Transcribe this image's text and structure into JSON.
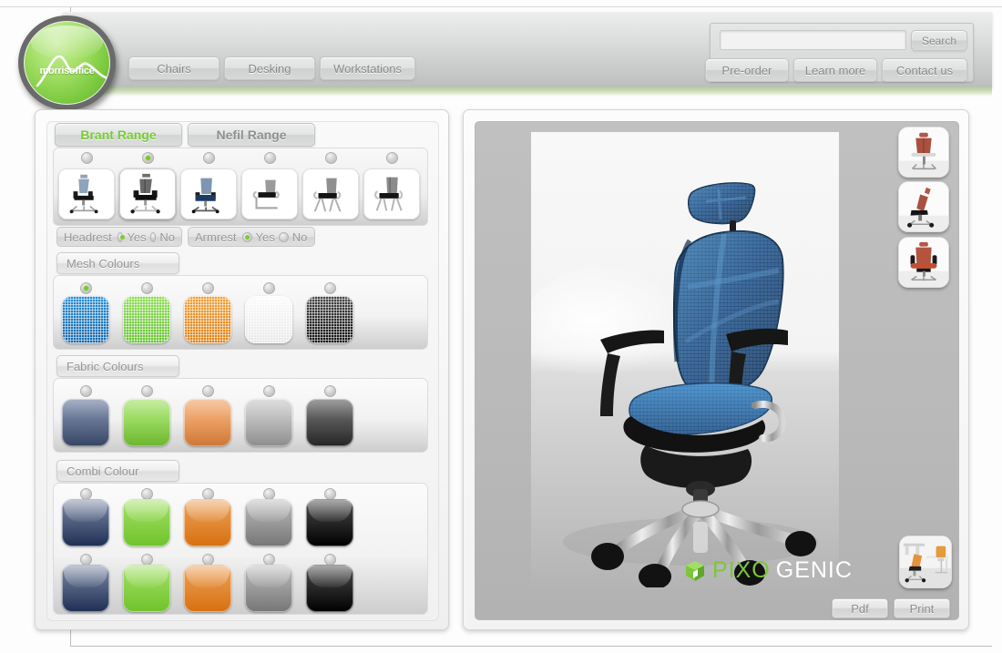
{
  "header": {
    "logo_text": "morrisoffice",
    "nav": [
      {
        "id": "chairs",
        "label": "Chairs"
      },
      {
        "id": "desking",
        "label": "Desking"
      },
      {
        "id": "workstations",
        "label": "Workstations"
      }
    ],
    "search": {
      "value": "",
      "placeholder": "",
      "button_label": "Search"
    },
    "actions": [
      {
        "id": "preorder",
        "label": "Pre-order"
      },
      {
        "id": "learnmore",
        "label": "Learn more"
      },
      {
        "id": "contactus",
        "label": "Contact us"
      }
    ],
    "accent_color": "#7ccb2e"
  },
  "configurator": {
    "ranges": [
      {
        "id": "brant",
        "label": "Brant Range",
        "active": true,
        "color": "#77cc33"
      },
      {
        "id": "nefil",
        "label": "Nefil Range",
        "active": false,
        "color": "#8f8f8f"
      }
    ],
    "models": [
      {
        "id": "model-1",
        "name": "executive-mesh-highback",
        "selected": false
      },
      {
        "id": "model-2",
        "name": "executive-mesh-headrest",
        "selected": true
      },
      {
        "id": "model-3",
        "name": "task-midback-blue",
        "selected": false
      },
      {
        "id": "model-4",
        "name": "cantilever-visitor",
        "selected": false
      },
      {
        "id": "model-5",
        "name": "four-leg-visitor",
        "selected": false
      },
      {
        "id": "model-6",
        "name": "stacking-mesh-chair",
        "selected": false
      }
    ],
    "options": [
      {
        "id": "headrest",
        "label": "Headrest",
        "yes_label": "Yes",
        "no_label": "No",
        "value": "Yes"
      },
      {
        "id": "armrest",
        "label": "Armrest",
        "yes_label": "Yes",
        "no_label": "No",
        "value": "Yes"
      }
    ],
    "sections": [
      {
        "id": "mesh",
        "label": "Mesh Colours",
        "swatches": [
          {
            "name": "blue",
            "color": "#2b8fd4",
            "color2": "#1565a8",
            "selected": true
          },
          {
            "name": "green",
            "color": "#8fdc56",
            "color2": "#63c22e",
            "selected": false
          },
          {
            "name": "orange",
            "color": "#f0a13b",
            "color2": "#e07e12",
            "selected": false
          },
          {
            "name": "white",
            "color": "#fbfbfb",
            "color2": "#e6e6e6",
            "selected": false
          },
          {
            "name": "black",
            "color": "#4a4a4a",
            "color2": "#101010",
            "selected": false
          }
        ]
      },
      {
        "id": "fabric",
        "label": "Fabric Colours",
        "swatches": [
          {
            "name": "slate-blue",
            "color": "#6b7b9c",
            "color2": "#3c4d70",
            "selected": false
          },
          {
            "name": "lime-green",
            "color": "#a0e065",
            "color2": "#79ca32",
            "selected": false
          },
          {
            "name": "orange",
            "color": "#efa469",
            "color2": "#e5843a",
            "selected": false
          },
          {
            "name": "grey",
            "color": "#c6c6c6",
            "color2": "#9d9d9d",
            "selected": false
          },
          {
            "name": "charcoal",
            "color": "#5a5a5a",
            "color2": "#2a2a2a",
            "selected": false
          }
        ]
      },
      {
        "id": "combi",
        "label": "Combi Colour",
        "swatches_row1": [
          {
            "name": "navy",
            "color": "#7e8ba6",
            "color2": "#1e2e54",
            "selected": false
          },
          {
            "name": "lime-green",
            "color": "#a5e168",
            "color2": "#6fc32b",
            "selected": false
          },
          {
            "name": "orange",
            "color": "#eda35d",
            "color2": "#d8700f",
            "selected": false
          },
          {
            "name": "grey",
            "color": "#bdbdbd",
            "color2": "#767676",
            "selected": false
          },
          {
            "name": "black",
            "color": "#4c4c4c",
            "color2": "#000000",
            "selected": false
          }
        ],
        "swatches_row2": [
          {
            "name": "navy",
            "color": "#7e8ba6",
            "color2": "#1e2e54",
            "selected": false
          },
          {
            "name": "lime-green",
            "color": "#a5e168",
            "color2": "#6fc32b",
            "selected": false
          },
          {
            "name": "orange",
            "color": "#eda35d",
            "color2": "#d8700f",
            "selected": false
          },
          {
            "name": "grey",
            "color": "#bdbdbd",
            "color2": "#767676",
            "selected": false
          },
          {
            "name": "black",
            "color": "#4c4c4c",
            "color2": "#000000",
            "selected": false
          }
        ]
      }
    ]
  },
  "preview": {
    "product": "blue mesh executive chair with headrest",
    "mesh_color": "#2b6fa8",
    "watermark": {
      "pixo": "PIXO",
      "genic": "GENIC",
      "logo_color": "#7cc63c"
    },
    "views": [
      {
        "id": "view-back",
        "name": "back-view-thumbnail"
      },
      {
        "id": "view-side",
        "name": "side-view-thumbnail"
      },
      {
        "id": "view-front",
        "name": "front-view-thumbnail"
      }
    ],
    "room_view": {
      "id": "view-room",
      "name": "office-room-scene-thumbnail"
    },
    "actions": [
      {
        "id": "pdf",
        "label": "Pdf"
      },
      {
        "id": "print",
        "label": "Print"
      }
    ]
  }
}
